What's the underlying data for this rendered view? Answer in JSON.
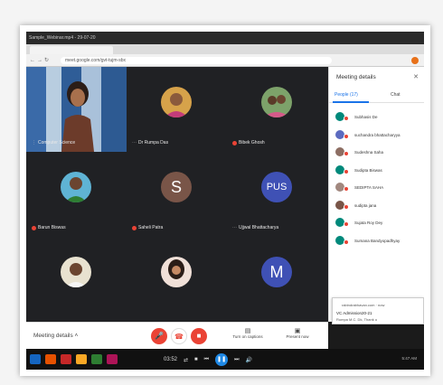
{
  "window": {
    "title": "Sample_Webinar.mp4 - 29-07-20"
  },
  "browser": {
    "url": "meet.google.com/gvt-tujm-sbx"
  },
  "tiles": [
    {
      "name": "Computer Science"
    },
    {
      "name": "Dr Rumpa Das"
    },
    {
      "name": "Bibek Ghosh"
    },
    {
      "name": "Barun Biswas"
    },
    {
      "name": "Saheli Patra",
      "initial": "S"
    },
    {
      "name": "Ujjwal Bhattacharya",
      "initial": "PUS"
    },
    {
      "name": ""
    },
    {
      "name": ""
    },
    {
      "name": "",
      "initial": "M"
    }
  ],
  "panel": {
    "title": "Meeting details",
    "tab_people": "People (17)",
    "tab_chat": "Chat",
    "participants": [
      {
        "name": "Subhasis De"
      },
      {
        "name": "suchandra bhattacharyya"
      },
      {
        "name": "Sudeshna Saha"
      },
      {
        "name": "Sudipta Biswas"
      },
      {
        "name": "SEDIPTA SAHA"
      },
      {
        "name": "sudipta jana"
      },
      {
        "name": "Sujata Roy Dey"
      },
      {
        "name": "Sumana Bandyopadhyay"
      }
    ]
  },
  "controls": {
    "meeting_details": "Meeting details",
    "caption_label": "Turn on captions",
    "present_label": "Present now"
  },
  "toast": {
    "line1": "rabindrabhavan.com · now",
    "line2": "VC Admission20-21",
    "line3": "Rumpa M.C. Dk, Thank u"
  },
  "player": {
    "time_left": "03:52",
    "time_right": "5:47 AM"
  },
  "colors": {
    "accent": "#1a73e8",
    "danger": "#ea4335",
    "meet_bg": "#202124"
  }
}
